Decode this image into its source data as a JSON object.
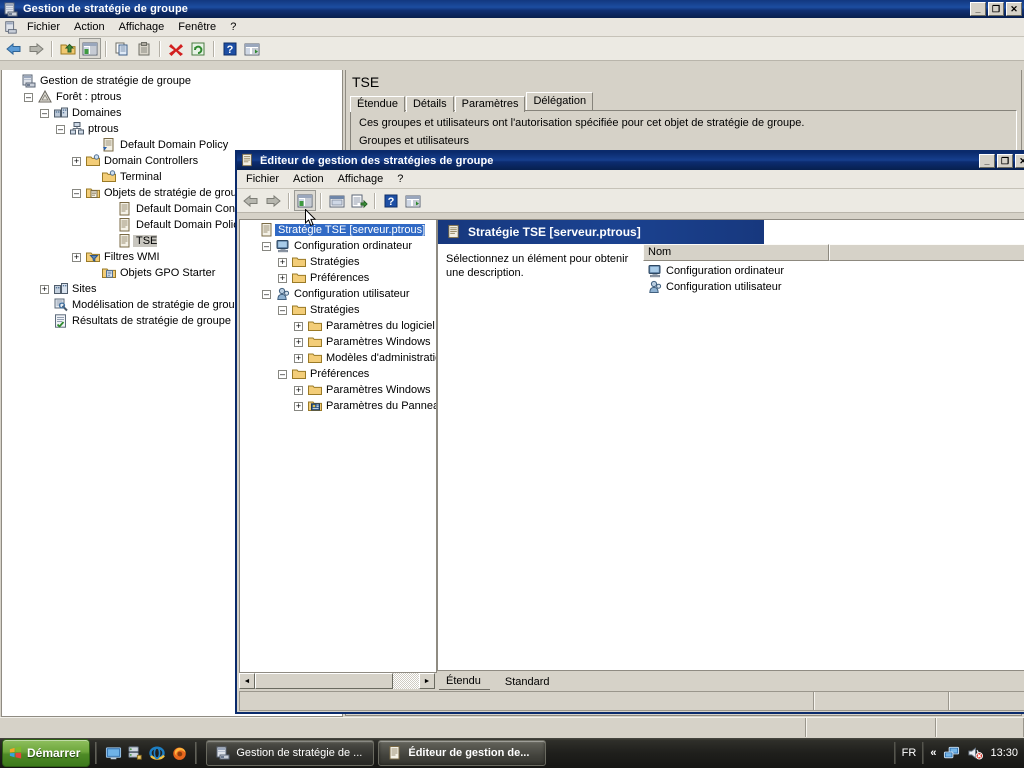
{
  "main_window": {
    "title": "Gestion de stratégie de groupe",
    "icon": "gpmc-console-icon",
    "controls": {
      "minimize": "_",
      "maximize": "❐",
      "close": "✕"
    },
    "menu": [
      "Fichier",
      "Action",
      "Affichage",
      "Fenêtre",
      "?"
    ],
    "toolbar": [
      "back-arrow-icon",
      "forward-arrow-icon",
      "separator",
      "up-folder-icon",
      "show-tree-icon",
      "separator",
      "copy-icon",
      "paste-icon",
      "separator",
      "delete-icon",
      "refresh-icon",
      "separator",
      "help-icon",
      "properties-icon"
    ],
    "tree": [
      {
        "label": "Gestion de stratégie de groupe",
        "indent": 0,
        "expander": "",
        "icon": "gpmc-console-icon"
      },
      {
        "label": "Forêt : ptrous",
        "indent": 1,
        "expander": "-",
        "icon": "forest-icon"
      },
      {
        "label": "Domaines",
        "indent": 2,
        "expander": "-",
        "icon": "domains-icon"
      },
      {
        "label": "ptrous",
        "indent": 3,
        "expander": "-",
        "icon": "domain-icon"
      },
      {
        "label": "Default Domain Policy",
        "indent": 5,
        "expander": "",
        "icon": "gpo-link-icon"
      },
      {
        "label": "Domain Controllers",
        "indent": 4,
        "expander": "+",
        "icon": "ou-icon"
      },
      {
        "label": "Terminal",
        "indent": 5,
        "expander": "",
        "icon": "ou-icon"
      },
      {
        "label": "Objets de stratégie de grou",
        "indent": 4,
        "expander": "-",
        "icon": "gpo-folder-icon"
      },
      {
        "label": "Default Domain Controll",
        "indent": 6,
        "expander": "",
        "icon": "gpo-icon"
      },
      {
        "label": "Default Domain Policy",
        "indent": 6,
        "expander": "",
        "icon": "gpo-icon"
      },
      {
        "label": "TSE",
        "indent": 6,
        "expander": "",
        "icon": "gpo-icon",
        "selected": "gray"
      },
      {
        "label": "Filtres WMI",
        "indent": 4,
        "expander": "+",
        "icon": "wmi-filter-icon"
      },
      {
        "label": "Objets GPO Starter",
        "indent": 5,
        "expander": "",
        "icon": "starter-gpo-icon"
      },
      {
        "label": "Sites",
        "indent": 2,
        "expander": "+",
        "icon": "sites-icon"
      },
      {
        "label": "Modélisation de stratégie de groupe",
        "indent": 2,
        "expander": "",
        "icon": "modeling-icon"
      },
      {
        "label": "Résultats de stratégie de groupe",
        "indent": 2,
        "expander": "",
        "icon": "results-icon"
      }
    ],
    "detail": {
      "heading": "TSE",
      "tabs": [
        "Étendue",
        "Détails",
        "Paramètres",
        "Délégation"
      ],
      "active_tab": "Délégation",
      "description": "Ces groupes et utilisateurs ont l'autorisation spécifiée pour cet objet de stratégie de groupe.",
      "description_cut": "Groupes et utilisateurs"
    }
  },
  "child_window": {
    "title": "Éditeur de gestion des stratégies de groupe",
    "icon": "gpme-icon",
    "controls": {
      "minimize": "_",
      "restore": "❐",
      "close": "✕"
    },
    "menu": [
      "Fichier",
      "Action",
      "Affichage",
      "?"
    ],
    "toolbar": [
      "back-arrow-icon",
      "forward-arrow-icon",
      "separator",
      "show-tree-icon",
      "separator",
      "properties-icon",
      "export-list-icon",
      "separator",
      "help-icon",
      "show-pane-icon"
    ],
    "tree": [
      {
        "label": "Stratégie TSE [serveur.ptrous]",
        "indent": 0,
        "expander": "",
        "icon": "gpo-icon",
        "selected": "blue"
      },
      {
        "label": "Configuration ordinateur",
        "indent": 1,
        "expander": "-",
        "icon": "computer-config-icon"
      },
      {
        "label": "Stratégies",
        "indent": 2,
        "expander": "+",
        "icon": "folder-icon"
      },
      {
        "label": "Préférences",
        "indent": 2,
        "expander": "+",
        "icon": "folder-icon"
      },
      {
        "label": "Configuration utilisateur",
        "indent": 1,
        "expander": "-",
        "icon": "user-config-icon"
      },
      {
        "label": "Stratégies",
        "indent": 2,
        "expander": "-",
        "icon": "folder-icon"
      },
      {
        "label": "Paramètres du logiciel",
        "indent": 3,
        "expander": "+",
        "icon": "folder-icon"
      },
      {
        "label": "Paramètres Windows",
        "indent": 3,
        "expander": "+",
        "icon": "folder-icon"
      },
      {
        "label": "Modèles d'administratio",
        "indent": 3,
        "expander": "+",
        "icon": "folder-icon"
      },
      {
        "label": "Préférences",
        "indent": 2,
        "expander": "-",
        "icon": "folder-icon"
      },
      {
        "label": "Paramètres Windows",
        "indent": 3,
        "expander": "+",
        "icon": "folder-icon"
      },
      {
        "label": "Paramètres du Pannea",
        "indent": 3,
        "expander": "+",
        "icon": "control-panel-icon"
      }
    ],
    "pane_header": "Stratégie TSE [serveur.ptrous]",
    "pane_description": "Sélectionnez un élément pour obtenir une description.",
    "list": {
      "columns": [
        "Nom",
        ""
      ],
      "rows": [
        {
          "name": "Configuration ordinateur",
          "icon": "computer-config-icon"
        },
        {
          "name": "Configuration utilisateur",
          "icon": "user-config-icon"
        }
      ]
    },
    "bottom_tabs": [
      "Étendu",
      "Standard"
    ],
    "active_bottom_tab": "Étendu",
    "hscroll": {
      "left_arrow": "◄",
      "right_arrow": "►"
    }
  },
  "taskbar": {
    "start_label": "Démarrer",
    "quick_launch": [
      "show-desktop-icon",
      "server-manager-icon",
      "internet-explorer-icon",
      "firefox-icon"
    ],
    "tasks": [
      {
        "label": "Gestion de stratégie de ...",
        "icon": "gpmc-console-icon",
        "active": false
      },
      {
        "label": "Éditeur de gestion de...",
        "icon": "gpme-icon",
        "active": true
      }
    ],
    "tray": {
      "language": "FR",
      "expand": "«",
      "icons": [
        "network-icon",
        "volume-muted-icon"
      ],
      "clock": "13:30"
    }
  },
  "colors": {
    "titlebar_blue": "#0c2c70",
    "selection_blue": "#316ac5",
    "window_face": "#d6d2c8",
    "taskbar_dark": "#1f1f1c",
    "start_green": "#6da63c"
  }
}
